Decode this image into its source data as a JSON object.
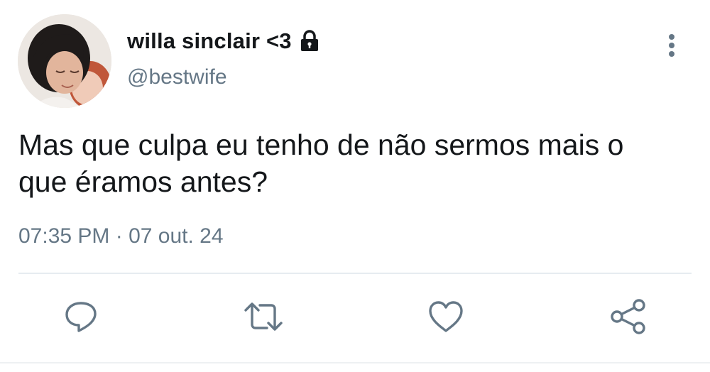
{
  "user": {
    "display_name": "willa sinclair <3",
    "handle": "@bestwife",
    "protected_icon": "lock-icon",
    "avatar_icon": "profile-photo"
  },
  "tweet": {
    "text": "Mas que culpa eu tenho de não sermos mais o\nque éramos antes?",
    "timestamp": "07:35 PM · 07 out. 24"
  },
  "actions": [
    {
      "name": "reply",
      "icon": "speech-bubble-icon"
    },
    {
      "name": "retweet",
      "icon": "retweet-icon"
    },
    {
      "name": "like",
      "icon": "heart-icon"
    },
    {
      "name": "share",
      "icon": "share-icon"
    }
  ],
  "colors": {
    "text_primary": "#14171a",
    "text_secondary": "#657786",
    "icon": "#657786",
    "divider": "#e6ecf0"
  }
}
